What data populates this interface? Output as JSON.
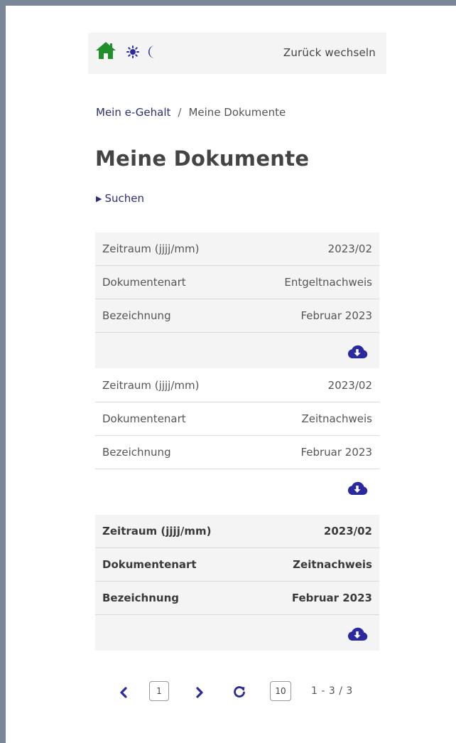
{
  "header": {
    "back_label": "Zurück wechseln",
    "icons": [
      "home-icon",
      "sun-icon",
      "moon-icon"
    ],
    "home_color": "#1f8f2a",
    "accent_color": "#2a2a9e"
  },
  "breadcrumb": {
    "parent": "Mein e-Gehalt",
    "separator": "/",
    "current": "Meine Dokumente"
  },
  "page_title": "Meine Dokumente",
  "search": {
    "label": "Suchen"
  },
  "documents": [
    {
      "period_label": "Zeitraum (jjjj/mm)",
      "period_value": "2023/02",
      "type_label": "Dokumentenart",
      "type_value": "Entgeltnachweis",
      "name_label": "Bezeichnung",
      "name_value": "Februar 2023"
    },
    {
      "period_label": "Zeitraum (jjjj/mm)",
      "period_value": "2023/02",
      "type_label": "Dokumentenart",
      "type_value": "Zeitnachweis",
      "name_label": "Bezeichnung",
      "name_value": "Februar 2023"
    },
    {
      "period_label": "Zeitraum (jjjj/mm)",
      "period_value": "2023/02",
      "type_label": "Dokumentenart",
      "type_value": "Zeitnachweis",
      "name_label": "Bezeichnung",
      "name_value": "Februar 2023"
    }
  ],
  "pagination": {
    "page": "1",
    "page_size": "10",
    "range": "1 - 3 / 3"
  }
}
